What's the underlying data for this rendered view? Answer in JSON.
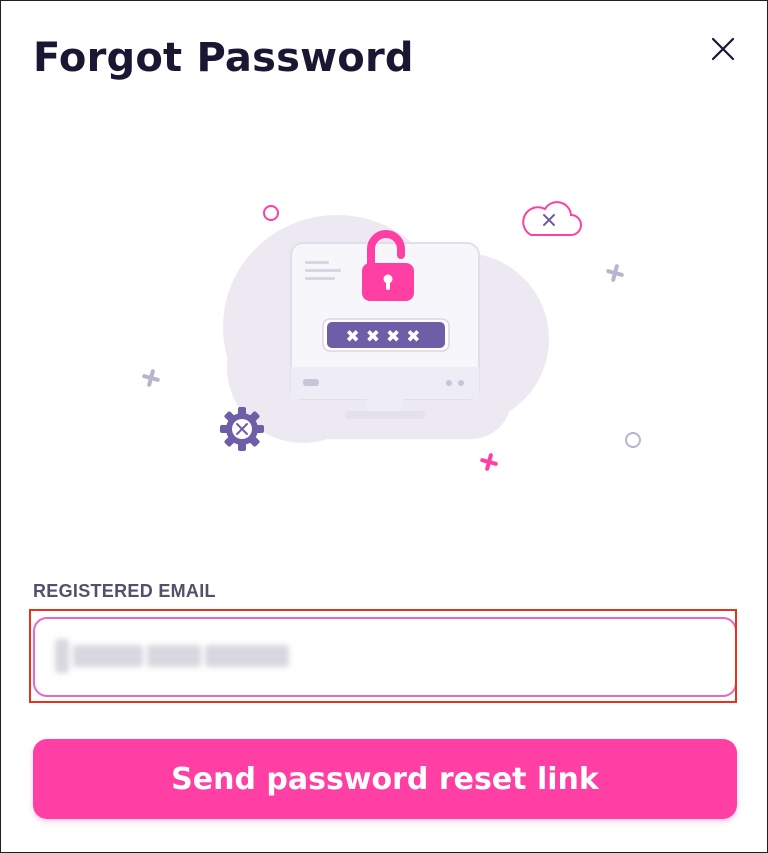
{
  "dialog": {
    "title": "Forgot Password",
    "close_icon": "close-icon"
  },
  "illustration": {
    "subject": "monitor-with-unlocked-padlock",
    "password_mask": "✖✖✖✖"
  },
  "form": {
    "email_label": "REGISTERED EMAIL",
    "email_value": "",
    "submit_label": "Send password reset link"
  },
  "colors": {
    "accent": "#ff3fa3",
    "title": "#1a1733",
    "label": "#54506a",
    "input_border": "#e667c4",
    "highlight": "#e8321c",
    "illustration_bg": "#ece9f3",
    "password_bar": "#6e5ea8"
  }
}
